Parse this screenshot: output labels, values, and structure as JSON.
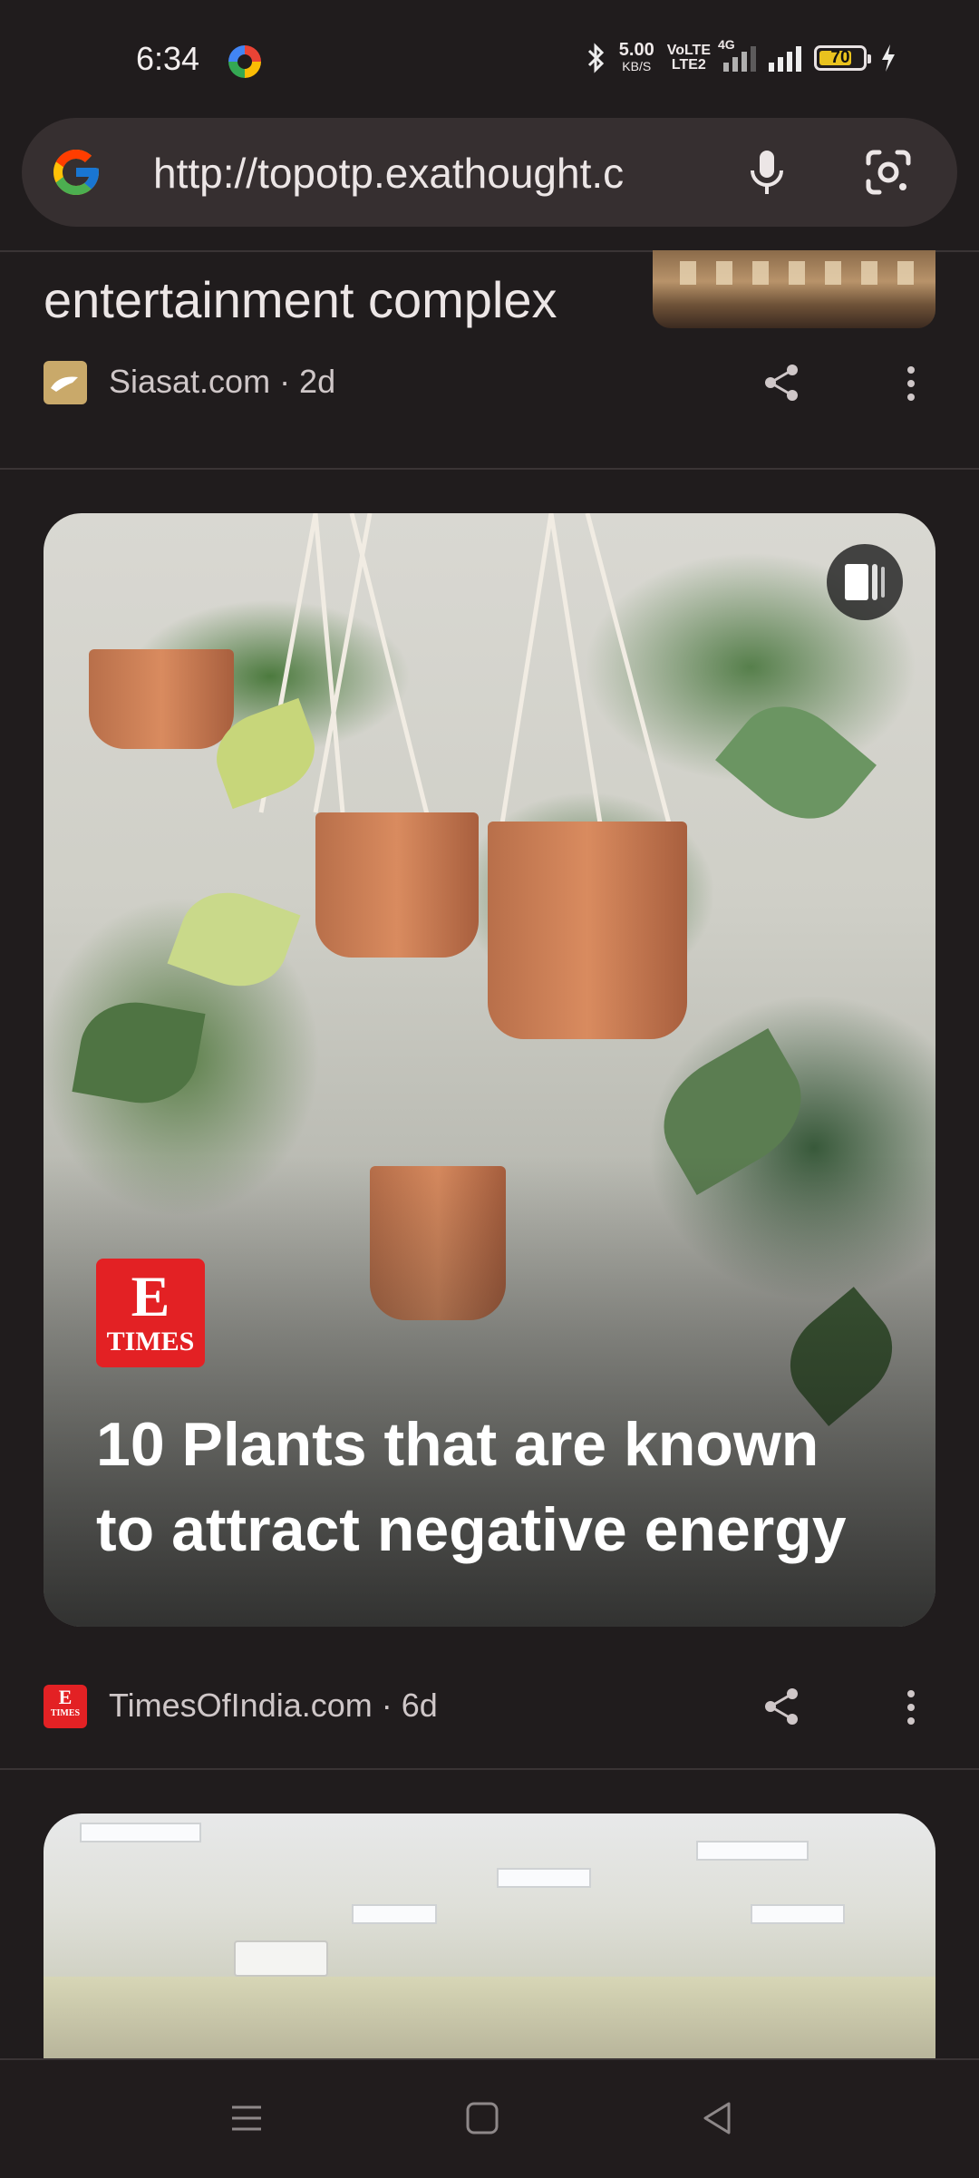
{
  "status_bar": {
    "time": "6:34",
    "net_speed": "5.00",
    "net_unit": "KB/S",
    "volte_top": "VoLTE",
    "volte_bottom": "LTE2",
    "signal_type": "4G",
    "battery_level": "70",
    "icons": [
      "bluetooth-icon",
      "signal-icon",
      "battery-icon",
      "charging-icon"
    ]
  },
  "address_bar": {
    "url": "http://topotp.exathought.c",
    "icons": [
      "google-logo-icon",
      "microphone-icon",
      "google-lens-icon"
    ]
  },
  "feed": {
    "card1": {
      "title": "entertainment complex",
      "source": "Siasat.com · 2d"
    },
    "card2": {
      "badge_top": "E",
      "badge_bottom": "TIMES",
      "headline": "10 Plants that are known to attract negative energy",
      "source": "TimesOfIndia.com · 6d",
      "favicon_label": "TIMES"
    }
  },
  "nav_bar": {
    "buttons": [
      "menu-icon",
      "home-icon",
      "back-icon"
    ]
  },
  "colors": {
    "background": "#201c1d",
    "urlbar": "#362f30",
    "times_red": "#e32124"
  }
}
